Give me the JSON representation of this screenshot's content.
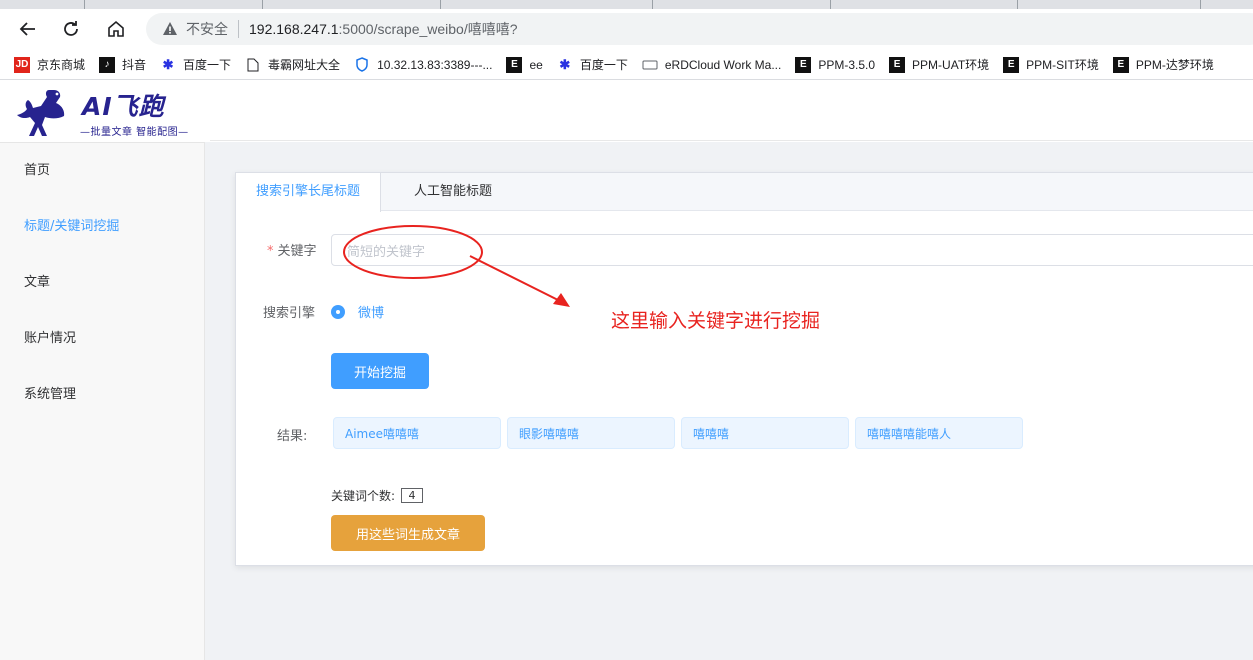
{
  "browser": {
    "insecure_label": "不安全",
    "url_host": "192.168.247.1",
    "url_path": ":5000/scrape_weibo/嘻嘻嘻?",
    "bookmarks": [
      {
        "label": "京东商城",
        "icon": "jd-icon"
      },
      {
        "label": "抖音",
        "icon": "douyin-icon"
      },
      {
        "label": "百度一下",
        "icon": "baidu-paw-icon"
      },
      {
        "label": "毒霸网址大全",
        "icon": "page-icon"
      },
      {
        "label": "10.32.13.83:3389---...",
        "icon": "shield-icon"
      },
      {
        "label": "ee",
        "icon": "e-icon"
      },
      {
        "label": "百度一下",
        "icon": "baidu-paw-icon"
      },
      {
        "label": "eRDCloud Work Ma...",
        "icon": "cloud-icon"
      },
      {
        "label": "PPM-3.5.0",
        "icon": "e-icon"
      },
      {
        "label": "PPM-UAT环境",
        "icon": "e-icon"
      },
      {
        "label": "PPM-SIT环境",
        "icon": "e-icon"
      },
      {
        "label": "PPM-达梦环境",
        "icon": "e-icon"
      }
    ]
  },
  "logo": {
    "title": "AI飞跑",
    "subtitle": "—批量文章 智能配图—"
  },
  "menu": {
    "items": [
      {
        "label": "首页",
        "active": false
      },
      {
        "label": "标题/关键词挖掘",
        "active": true
      },
      {
        "label": "文章",
        "active": false
      },
      {
        "label": "账户情况",
        "active": false
      },
      {
        "label": "系统管理",
        "active": false
      }
    ]
  },
  "tabs": [
    {
      "label": "搜索引擎长尾标题",
      "active": true
    },
    {
      "label": "人工智能标题",
      "active": false
    }
  ],
  "form": {
    "required_mark": "*",
    "keyword_label": "关键字",
    "keyword_placeholder": "简短的关键字",
    "engine_label": "搜索引擎",
    "engine_option": "微博",
    "start_button": "开始挖掘",
    "result_label": "结果:",
    "results": [
      "Aimee嘻嘻嘻",
      "眼影嘻嘻嘻",
      "嘻嘻嘻",
      "嘻嘻嘻嘻能嘻人"
    ],
    "count_label": "关键词个数:",
    "count_value": "4",
    "generate_button": "用这些词生成文章"
  },
  "annotation": {
    "text": "这里输入关键字进行挖掘",
    "color": "#e8231f"
  },
  "colors": {
    "primary": "#409eff",
    "warning": "#e6a23c",
    "brand": "#27238f"
  }
}
